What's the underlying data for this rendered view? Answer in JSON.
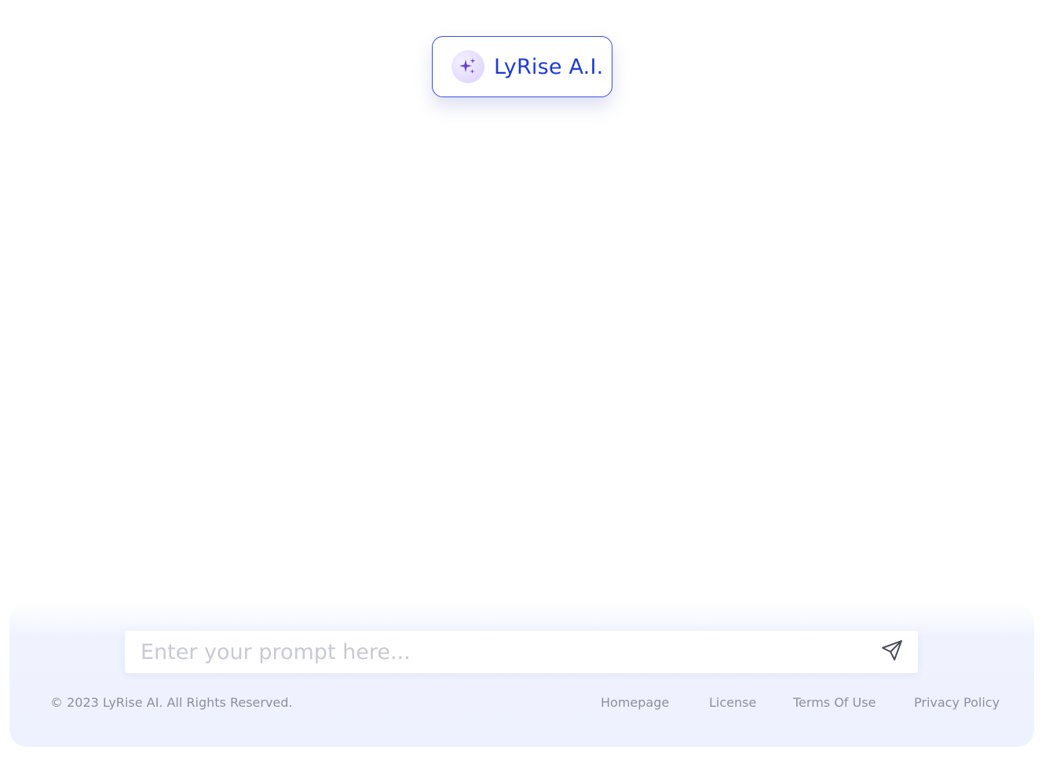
{
  "brand": {
    "name": "LyRise A.I.",
    "icon": "sparkles-icon",
    "accent_color": "#1f3bd3",
    "border_color": "#3b4fe0",
    "icon_color": "#6a3fd8"
  },
  "composer": {
    "placeholder": "Enter your prompt here...",
    "value": "",
    "send_icon": "send-icon"
  },
  "footer": {
    "copyright": "© 2023 LyRise AI. All Rights Reserved.",
    "links": [
      {
        "label": "Homepage"
      },
      {
        "label": "License"
      },
      {
        "label": "Terms Of Use"
      },
      {
        "label": "Privacy Policy"
      }
    ],
    "panel_color": "#eef2fe",
    "text_color": "#8d909c"
  }
}
